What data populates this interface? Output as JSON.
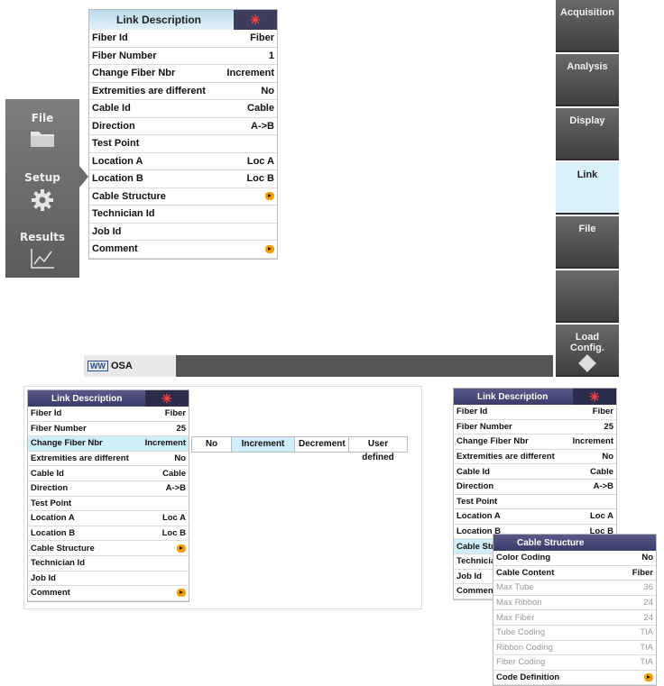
{
  "left_strip": {
    "items": [
      {
        "label": "File",
        "icon": "folder-icon"
      },
      {
        "label": "Setup",
        "icon": "gear-icon"
      },
      {
        "label": "Results",
        "icon": "chart-icon"
      }
    ]
  },
  "right_strip": {
    "items": [
      {
        "label": "Acquisition"
      },
      {
        "label": "Analysis"
      },
      {
        "label": "Display"
      },
      {
        "label": "Link"
      },
      {
        "label": "File"
      },
      {
        "label": ""
      },
      {
        "label": "Load Config."
      }
    ],
    "active_index": 3
  },
  "status": {
    "mode": "OSA",
    "wave_label": "WW"
  },
  "link_table": {
    "title": "Link Description",
    "rows": [
      {
        "label": "Fiber Id",
        "value": "Fiber"
      },
      {
        "label": "Fiber Number",
        "value": "1"
      },
      {
        "label": "Change Fiber Nbr",
        "value": "Increment"
      },
      {
        "label": "Extremities are different",
        "value": "No"
      },
      {
        "label": "Cable Id",
        "value": "Cable"
      },
      {
        "label": "Direction",
        "value": "A->B"
      },
      {
        "label": "Test Point",
        "value": ""
      },
      {
        "label": "Location A",
        "value": "Loc A"
      },
      {
        "label": "Location B",
        "value": "Loc B"
      },
      {
        "label": "Cable Structure",
        "value": ""
      },
      {
        "label": "Technician Id",
        "value": ""
      },
      {
        "label": "Job Id",
        "value": ""
      },
      {
        "label": "Comment",
        "value": ""
      }
    ]
  },
  "link_table_2": {
    "title": "Link Description",
    "rows": [
      {
        "label": "Fiber Id",
        "value": "Fiber"
      },
      {
        "label": "Fiber Number",
        "value": "25"
      },
      {
        "label": "Change Fiber Nbr",
        "value": "Increment"
      },
      {
        "label": "Extremities are different",
        "value": "No"
      },
      {
        "label": "Cable Id",
        "value": "Cable"
      },
      {
        "label": "Direction",
        "value": "A->B"
      },
      {
        "label": "Test Point",
        "value": ""
      },
      {
        "label": "Location A",
        "value": "Loc A"
      },
      {
        "label": "Location B",
        "value": "Loc B"
      },
      {
        "label": "Cable Structure",
        "value": ""
      },
      {
        "label": "Technician Id",
        "value": ""
      },
      {
        "label": "Job Id",
        "value": ""
      },
      {
        "label": "Comment",
        "value": ""
      }
    ],
    "options": [
      "No",
      "Increment",
      "Decrement",
      "User defined"
    ],
    "selected_option": "Increment"
  },
  "link_table_3": {
    "title": "Link Description",
    "rows": [
      {
        "label": "Fiber Id",
        "value": "Fiber"
      },
      {
        "label": "Fiber Number",
        "value": "25"
      },
      {
        "label": "Change Fiber Nbr",
        "value": "Increment"
      },
      {
        "label": "Extremities are different",
        "value": "No"
      },
      {
        "label": "Cable Id",
        "value": "Cable"
      },
      {
        "label": "Direction",
        "value": "A->B"
      },
      {
        "label": "Test Point",
        "value": ""
      },
      {
        "label": "Location A",
        "value": "Loc A"
      },
      {
        "label": "Location B",
        "value": "Loc B"
      },
      {
        "label": "Cable Stru",
        "value": ""
      },
      {
        "label": "Technicia",
        "value": ""
      },
      {
        "label": "Job Id",
        "value": ""
      },
      {
        "label": "Comment",
        "value": ""
      }
    ]
  },
  "cable_structure": {
    "title": "Cable Structure",
    "rows": [
      {
        "label": "Color Coding",
        "value": "No"
      },
      {
        "label": "Cable Content",
        "value": "Fiber"
      },
      {
        "label": "Max Tube",
        "value": "36"
      },
      {
        "label": "Max Ribbon",
        "value": "24"
      },
      {
        "label": "Max Fiber",
        "value": "24"
      },
      {
        "label": "Tube Coding",
        "value": "TIA"
      },
      {
        "label": "Ribbon Coding",
        "value": "TIA"
      },
      {
        "label": "Fiber Coding",
        "value": "TIA"
      },
      {
        "label": "Code Definition",
        "value": ""
      }
    ]
  }
}
